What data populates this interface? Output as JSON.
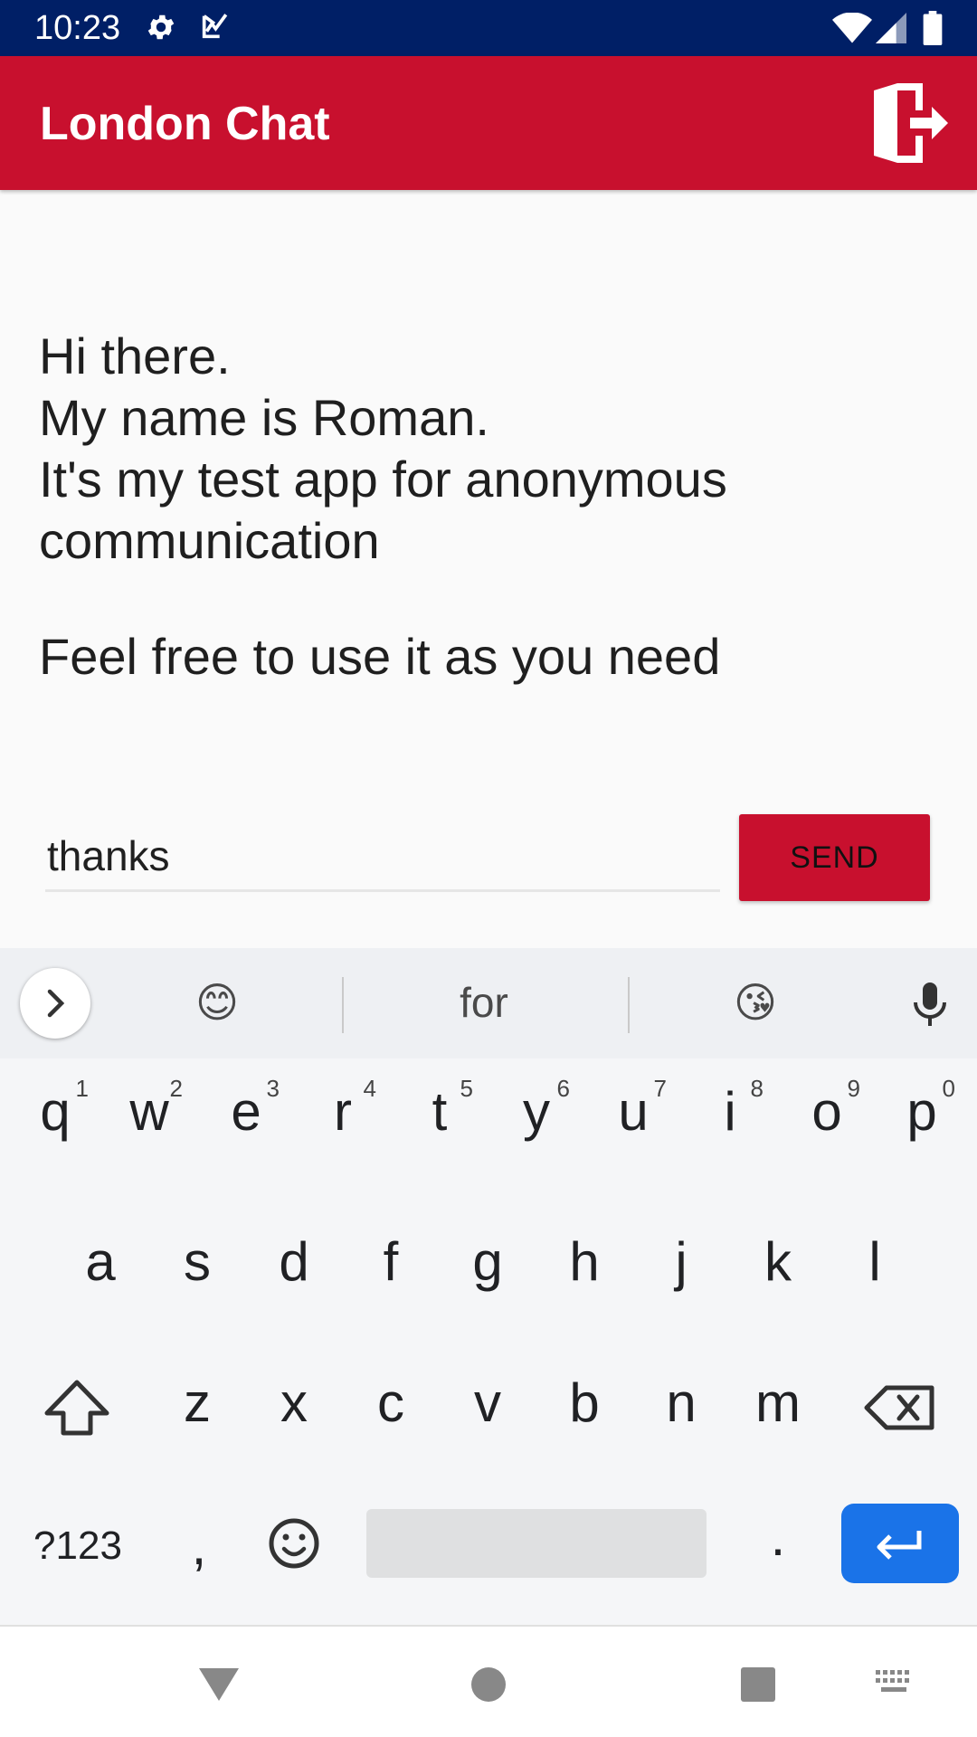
{
  "status_bar": {
    "time": "10:23",
    "icons": [
      "gear-icon",
      "checkbox-icon",
      "wifi-icon",
      "signal-icon",
      "battery-icon"
    ]
  },
  "app_bar": {
    "title": "London Chat",
    "background_color": "#c8102e",
    "action_icon": "logout-icon"
  },
  "messages": {
    "lines": [
      "Hi there.",
      "My name is Roman.",
      "It's my test app for anonymous",
      "communication"
    ],
    "second_paragraph": "Feel free to use it as you need"
  },
  "composer": {
    "input_value": "thanks",
    "send_label": "SEND"
  },
  "keyboard": {
    "suggestions": [
      "😊",
      "for",
      "😘"
    ],
    "row1": [
      {
        "key": "q",
        "hint": "1"
      },
      {
        "key": "w",
        "hint": "2"
      },
      {
        "key": "e",
        "hint": "3"
      },
      {
        "key": "r",
        "hint": "4"
      },
      {
        "key": "t",
        "hint": "5"
      },
      {
        "key": "y",
        "hint": "6"
      },
      {
        "key": "u",
        "hint": "7"
      },
      {
        "key": "i",
        "hint": "8"
      },
      {
        "key": "o",
        "hint": "9"
      },
      {
        "key": "p",
        "hint": "0"
      }
    ],
    "row2": [
      "a",
      "s",
      "d",
      "f",
      "g",
      "h",
      "j",
      "k",
      "l"
    ],
    "row3": [
      "z",
      "x",
      "c",
      "v",
      "b",
      "n",
      "m"
    ],
    "symbols_label": "?123",
    "comma_label": ",",
    "period_label": ".",
    "enter_color": "#1a73e8"
  },
  "nav_bar": {
    "icons": [
      "back-icon",
      "home-icon",
      "recents-icon",
      "keyboard-switch-icon"
    ]
  }
}
